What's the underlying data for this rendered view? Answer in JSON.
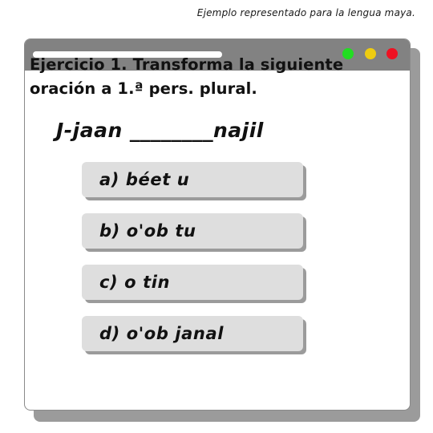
{
  "caption": "Ejemplo representado para la lengua maya.",
  "window": {
    "controls": [
      {
        "name": "green",
        "color": "#22dd22"
      },
      {
        "name": "yellow",
        "color": "#eecc11"
      },
      {
        "name": "red",
        "color": "#ee1122"
      }
    ]
  },
  "exercise": {
    "question_line1": "Ejercicio 1. Transforma la siguiente",
    "question_line2": "oración a 1.ª pers. plural.",
    "sentence": "J-jaan ________najil"
  },
  "options": [
    {
      "label": "a) béet u"
    },
    {
      "label": "b) o'ob tu"
    },
    {
      "label": "c) o tin"
    },
    {
      "label": "d) o'ob janal"
    }
  ]
}
